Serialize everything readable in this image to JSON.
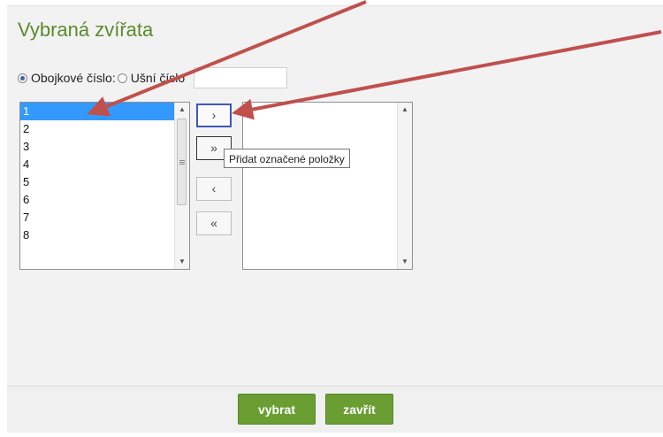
{
  "dialog": {
    "title": "Vybraná zvířata"
  },
  "id_type": {
    "option_collar": {
      "label": "Obojkové číslo:",
      "checked": true
    },
    "option_ear": {
      "label": "Ušní číslo",
      "checked": false
    },
    "input_value": ""
  },
  "available_list": {
    "items": [
      "1",
      "2",
      "3",
      "4",
      "5",
      "6",
      "7",
      "8"
    ],
    "selected_index": 0
  },
  "selected_list": {
    "items": []
  },
  "transfer_buttons": {
    "add_selected": "›",
    "add_all": "»",
    "remove_selected": "‹",
    "remove_all": "«",
    "tooltip": "Přidat označené položky"
  },
  "footer": {
    "select_label": "vybrat",
    "close_label": "zavřít"
  },
  "annotation": {
    "arrow_color": "#c0504d"
  }
}
